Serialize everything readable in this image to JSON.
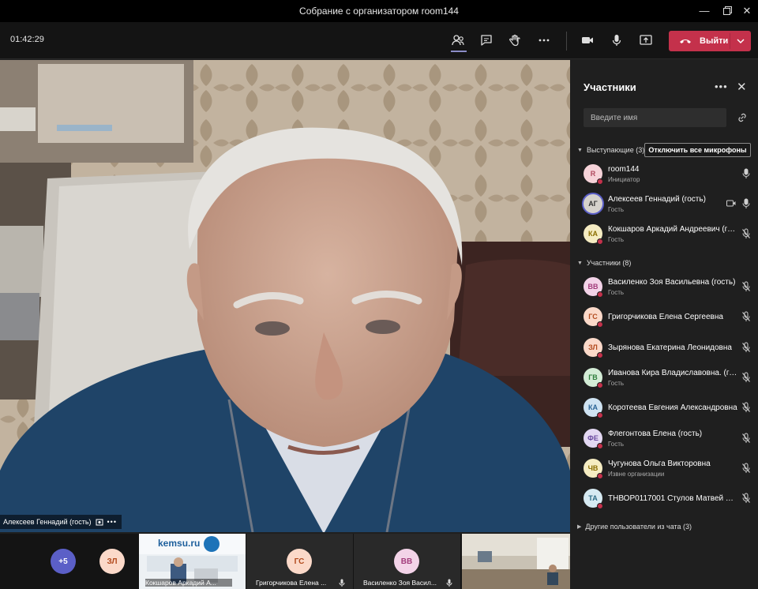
{
  "window": {
    "title": "Собрание с организатором room144"
  },
  "toolbar": {
    "timer": "01:42:29",
    "leave_label": "Выйти"
  },
  "video": {
    "name": "Алексеев Геннадий (гость)"
  },
  "panel": {
    "title": "Участники",
    "search_placeholder": "Введите имя",
    "presenters_header": "Выступающие (3)",
    "mute_all": "Отключить все микрофоны",
    "attendees_header": "Участники (8)",
    "others_header": "Другие пользователи из чата (3)",
    "presenters": [
      {
        "initials": "R",
        "name": "room144",
        "role": "Инициатор",
        "avatar_bg": "#f6d3d9",
        "avatar_fg": "#b04a5f"
      },
      {
        "initials": "АГ",
        "name": "Алексеев Геннадий (гость)",
        "role": "Гость",
        "avatar_bg": "#d6d2cc",
        "avatar_fg": "#333333"
      },
      {
        "initials": "КА",
        "name": "Кокшаров Аркадий Андреевич (гость)",
        "role": "Гость",
        "avatar_bg": "#f5ecc2",
        "avatar_fg": "#8a6d00"
      }
    ],
    "attendees": [
      {
        "initials": "ВВ",
        "name": "Василенко Зоя Васильевна (гость)",
        "role": "Гость",
        "avatar_bg": "#f3d3e8",
        "avatar_fg": "#a23c7b"
      },
      {
        "initials": "ГС",
        "name": "Григорчикова Елена Сергеевна",
        "role": "",
        "avatar_bg": "#fbd9c9",
        "avatar_fg": "#b24a1d"
      },
      {
        "initials": "ЗЛ",
        "name": "Зырянова Екатерина Леонидовна",
        "role": "",
        "avatar_bg": "#fbd9c9",
        "avatar_fg": "#b24a1d"
      },
      {
        "initials": "ГВ",
        "name": "Иванова Кира Владиславовна. (гость)",
        "role": "Гость",
        "avatar_bg": "#d3ecd6",
        "avatar_fg": "#2e7d3c"
      },
      {
        "initials": "КА",
        "name": "Коротеева Евгения Александровна",
        "role": "",
        "avatar_bg": "#cfe3f2",
        "avatar_fg": "#2a6496"
      },
      {
        "initials": "ФЕ",
        "name": "Флегонтова Елена (гость)",
        "role": "Гость",
        "avatar_bg": "#e3d8f2",
        "avatar_fg": "#6b4aa0"
      },
      {
        "initials": "ЧВ",
        "name": "Чугунова Ольга Викторовна",
        "role": "Извне организации",
        "avatar_bg": "#f5ecc2",
        "avatar_fg": "#8a6d00"
      },
      {
        "initials": "ТА",
        "name": "ТНВОР0117001 Стулов Матвей Андреевич",
        "role": "",
        "avatar_bg": "#d6eaf2",
        "avatar_fg": "#2a6a84"
      }
    ]
  },
  "strip": {
    "more_count": "+5",
    "tile_zl": "ЗЛ",
    "kemsu_logo": "kemsu.ru",
    "kemsu_name": "Кокшаров Аркадий А...",
    "gs_initials": "ГС",
    "gs_name": "Григорчикова Елена ...",
    "vv_initials": "ВВ",
    "vv_name": "Василенко Зоя Васил..."
  }
}
